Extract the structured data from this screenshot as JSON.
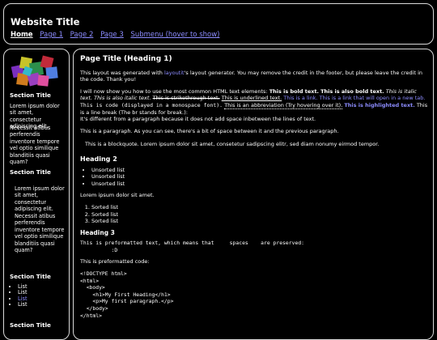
{
  "header": {
    "title": "Website Title",
    "nav": [
      "Home",
      "Page 1",
      "Page 2",
      "Page 3",
      "Submenu (hover to show)"
    ]
  },
  "sidebar": {
    "section1_title": "Section Title",
    "section1_p1": "Lorem ipsum dolor sit amet, consectetur adipiscing elit.",
    "section1_p2": "Necessit atibus perferendis inventore tempore vel optio similique blanditiis quasi quam?",
    "section2_title": "Section Title",
    "section2_p1": "Lorem ipsum dolor sit amet, consectetur adipiscing elit.",
    "section2_p2": "Necessit atibus perferendis inventore tempore vel optio similique blanditiis quasi quam?",
    "section3_title": "Section Title",
    "list": [
      "List",
      "List",
      "List",
      "List"
    ],
    "section4_title": "Section Title"
  },
  "main": {
    "h1": "Page Title (Heading 1)",
    "intro_1": "This layout was generated with ",
    "intro_link": "layoutit",
    "intro_2": "'s layout generator. You may remove the credit in the footer, but please leave the credit in the code. Thank you!",
    "elem_1": "I will now show you how to use the most common HTML text elements: ",
    "bold1": "This is bold text.",
    "bold2": "This is also bold text.",
    "italic1": "This is italic text.",
    "italic2": "This is also italic text.",
    "strike": "This is strikethrough text.",
    "underline": "This is underlined text.",
    "link1": "This is a link.",
    "link2": "This is a link that will open in a new tab.",
    "code": "This is code (displayed in a monospace font).",
    "abbr": "This is an abbreviation (Try hovering over it).",
    "highlight": "This is highlighted text.",
    "linebreak_1": "This is a line break (The br stands for break.):",
    "linebreak_2": "It's different from a paragraph because it does not add space inbetween the lines of text.",
    "para": "This is a paragraph. As you can see, there's a bit of space between it and the previous paragraph.",
    "blockquote": "This is a blockquote. Lorem ipsum dolor sit amet, consetetur sadipscing elitr, sed diam nonumy eirmod tempor.",
    "h2": "Heading 2",
    "ul": [
      "Unsorted list",
      "Unsorted list",
      "Unsorted list"
    ],
    "lorem": "Lorem ipsum dolor sit amet.",
    "ol": [
      "Sorted list",
      "Sorted list",
      "Sorted list"
    ],
    "h3": "Heading 3",
    "pre1": "This is preformatted text, which means that     spaces    are preserved:\n          :D",
    "pre_code_label": "This is preformatted code:",
    "pre2": "<!DOCTYPE html>\n<html>\n  <body>\n    <h1>My First Heading</h1>\n    <p>My first paragraph.</p>\n  </body>\n</html>"
  }
}
